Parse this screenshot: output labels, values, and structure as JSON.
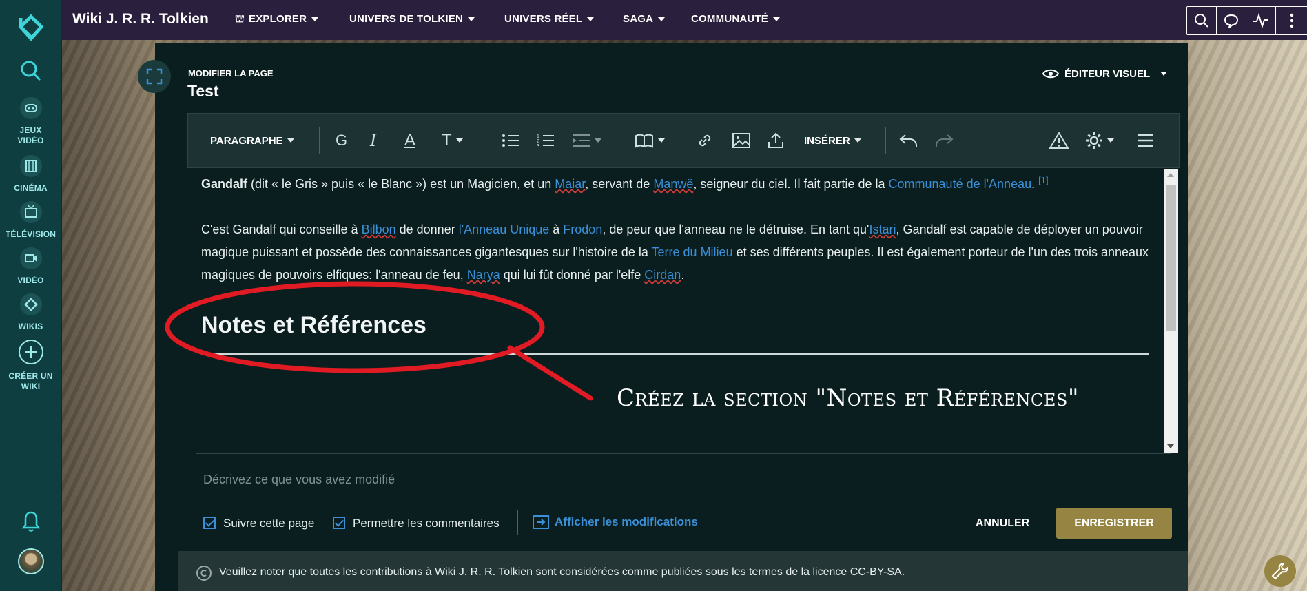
{
  "header": {
    "wiki_name": "Wiki J. R. R. Tolkien",
    "nav": [
      {
        "label": "EXPLORER"
      },
      {
        "label": "UNIVERS DE TOLKIEN"
      },
      {
        "label": "UNIVERS RÉEL"
      },
      {
        "label": "SAGA"
      },
      {
        "label": "COMMUNAUTÉ"
      }
    ],
    "tools": [
      "search-icon",
      "discussion-icon",
      "activity-icon",
      "more-icon"
    ]
  },
  "rail": {
    "items": [
      {
        "label": "JEUX VIDÉO",
        "icon": "gamepad-icon"
      },
      {
        "label": "CINÉMA",
        "icon": "film-icon"
      },
      {
        "label": "TÉLÉVISION",
        "icon": "tv-icon"
      },
      {
        "label": "VIDÉO",
        "icon": "video-icon"
      },
      {
        "label": "WIKIS",
        "icon": "fandom-icon"
      },
      {
        "label": "CRÉER UN WIKI",
        "icon": "plus-icon"
      }
    ]
  },
  "editor": {
    "mode_label": "MODIFIER LA PAGE",
    "page_title": "Test",
    "visual_editor": "ÉDITEUR VISUEL",
    "toolbar": {
      "paragraph": "PARAGRAPHE",
      "bold": "G",
      "italic": "I",
      "text_color": "A",
      "text_style": "T",
      "insert": "INSÉRER"
    },
    "content": {
      "p1": {
        "bold_name": "Gandalf",
        "t1": " (dit « le Gris » puis « le Blanc ») est un Magicien, et un ",
        "l1": "Maiar",
        "t2": ", servant de ",
        "l2": "Manwë",
        "t3": ", seigneur du ciel. Il fait partie de la ",
        "l3": "Communauté de l'Anneau",
        "t4": ". ",
        "ref": "[1]"
      },
      "p2": {
        "t1": "C'est Gandalf qui conseille à ",
        "l1": "Bilbon",
        "t2": " de donner ",
        "l2": "l'Anneau Unique",
        "t3": " à ",
        "l3": "Frodon",
        "t4": ", de peur que l'anneau ne le détruise. En tant qu'",
        "l4": "Istari",
        "t5": ", Gandalf est capable de déployer un pouvoir magique puissant et possède des connaissances gigantesques sur l'histoire de la ",
        "l5": "Terre du Milieu",
        "t6": " et ses différents peuples. Il est également porteur de l'un des trois anneaux magiques de pouvoirs elfiques: l'anneau de feu, ",
        "l6": "Narya",
        "t7": " qui lui fût donné par l'elfe ",
        "l7": "Cirdan",
        "t8": "."
      },
      "heading": "Notes et Références"
    },
    "annotation": "Créez la section \"Notes et Références\"",
    "summary_placeholder": "Décrivez ce que vous avez modifié",
    "watch_label": "Suivre cette page",
    "comments_label": "Permettre les commentaires",
    "show_changes": "Afficher les modifications",
    "cancel": "ANNULER",
    "save": "ENREGISTRER",
    "license": "Veuillez noter que toutes les contributions à Wiki J. R. R. Tolkien sont considérées comme publiées sous les termes de la licence CC-BY-SA."
  },
  "colors": {
    "rail": "#0f3e40",
    "topbar": "#2b1f3e",
    "link": "#3a8fd6",
    "save_button": "#968443",
    "annotation_circle": "#e01b24"
  }
}
